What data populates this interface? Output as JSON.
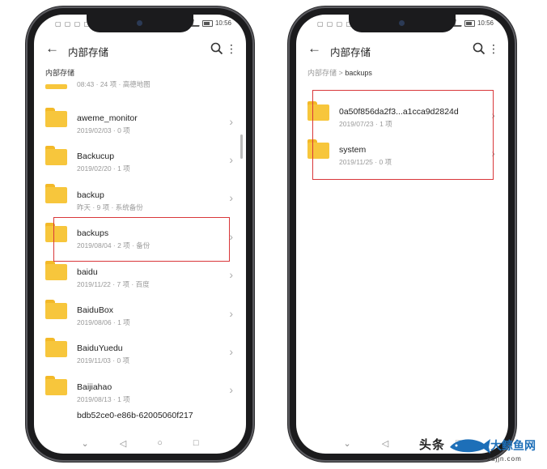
{
  "statusbar": {
    "left_icons": "▢ ▢ ▢ ▢",
    "time": "10:56"
  },
  "left_screen": {
    "title": "内部存储",
    "breadcrumb": "内部存储",
    "partial_top_meta": "08:43 · 24 项 · 高德地图",
    "items": [
      {
        "name": "aweme_monitor",
        "meta": "2019/02/03 · 0 项"
      },
      {
        "name": "Backucup",
        "meta": "2019/02/20 · 1 项"
      },
      {
        "name": "backup",
        "meta": "昨天 · 9 项 · 系统备份"
      },
      {
        "name": "backups",
        "meta": "2019/08/04 · 2 项 · 备份"
      },
      {
        "name": "baidu",
        "meta": "2019/11/22 · 7 项 · 百度"
      },
      {
        "name": "BaiduBox",
        "meta": "2019/08/06 · 1 项"
      },
      {
        "name": "BaiduYuedu",
        "meta": "2019/11/03 · 0 项"
      },
      {
        "name": "Baijiahao",
        "meta": "2019/08/13 · 1 项"
      }
    ],
    "partial_bottom_name": "bdb52ce0-e86b-62005060f217"
  },
  "right_screen": {
    "title": "内部存储",
    "breadcrumb_root": "内部存储",
    "breadcrumb_sep": ">",
    "breadcrumb_current": "backups",
    "items": [
      {
        "name": "0a50f856da2f3...a1cca9d2824d",
        "meta": "2019/07/23 · 1 项"
      },
      {
        "name": "system",
        "meta": "2019/11/25 · 0 项"
      }
    ]
  },
  "icons": {
    "back": "←",
    "more": "⋮",
    "chevron": "›",
    "nav_back": "◁",
    "nav_home": "○",
    "nav_recent": "□",
    "nav_down": "⌄"
  },
  "colors": {
    "folder": "#f7c63c",
    "highlight": "#d9373a"
  },
  "watermark": {
    "brand": "头条",
    "site": "xajjn.com",
    "wordmark": "大鲸鱼网"
  }
}
